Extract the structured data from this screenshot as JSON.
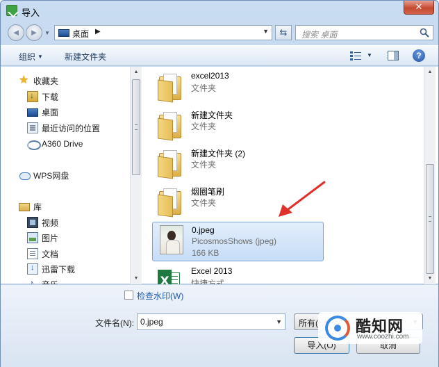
{
  "window": {
    "title": "导入",
    "close_label": "✕"
  },
  "nav": {
    "back_glyph": "◄",
    "forward_glyph": "►",
    "history_glyph": "▼",
    "address": {
      "location": "桌面",
      "separator": "▶",
      "dropdown_glyph": "▼"
    },
    "refresh_glyph": "⇆",
    "search_placeholder": "搜索 桌面"
  },
  "toolbar": {
    "organize_label": "组织",
    "organize_caret": "▼",
    "new_folder_label": "新建文件夹",
    "views_caret": "▼",
    "help_label": "?"
  },
  "sidebar": {
    "items": [
      {
        "label": "收藏夹",
        "icon": "star-icon"
      },
      {
        "label": "下载",
        "icon": "downloads-icon"
      },
      {
        "label": "桌面",
        "icon": "desktop-icon"
      },
      {
        "label": "最近访问的位置",
        "icon": "recent-places-icon"
      },
      {
        "label": "A360 Drive",
        "icon": "a360-drive-icon"
      },
      {
        "label": "WPS网盘",
        "icon": "cloud-drive-icon"
      },
      {
        "label": "库",
        "icon": "libraries-icon"
      },
      {
        "label": "视频",
        "icon": "videos-icon"
      },
      {
        "label": "图片",
        "icon": "pictures-icon"
      },
      {
        "label": "文档",
        "icon": "documents-icon"
      },
      {
        "label": "迅雷下载",
        "icon": "xunlei-download-icon"
      },
      {
        "label": "音乐",
        "icon": "music-icon"
      }
    ],
    "scroll_up": "▲",
    "scroll_down": "▼"
  },
  "files": [
    {
      "name": "excel2013",
      "line1": "文件夹",
      "line2": "",
      "icon": "folder-icon",
      "selected": false
    },
    {
      "name": "新建文件夹",
      "line1": "文件夹",
      "line2": "",
      "icon": "folder-icon",
      "selected": false
    },
    {
      "name": "新建文件夹 (2)",
      "line1": "文件夹",
      "line2": "",
      "icon": "folder-icon",
      "selected": false
    },
    {
      "name": "烟圈笔刷",
      "line1": "文件夹",
      "line2": "",
      "icon": "folder-icon",
      "selected": false
    },
    {
      "name": "0.jpeg",
      "line1": "PicosmosShows (jpeg)",
      "line2": "166 KB",
      "icon": "image-thumbnail-icon",
      "selected": true
    },
    {
      "name": "Excel 2013",
      "line1": "快捷方式",
      "line2": "",
      "icon": "excel-icon",
      "selected": false
    }
  ],
  "file_scroll": {
    "up": "▲",
    "down": "▼"
  },
  "bottom": {
    "watermark_checkbox_label": "检查水印(W)",
    "watermark_checked": false,
    "filename_label": "文件名(N):",
    "filename_value": "0.jpeg",
    "filename_dropdown": "▼",
    "filetype_value": "所有(*.*)",
    "filetype_dropdown": "▼",
    "import_label": "导入(O)",
    "cancel_label": "取消"
  },
  "watermark_logo": {
    "title": "酷知网",
    "url": "www.coozhi.com"
  },
  "colors": {
    "accent": "#3c7fb1",
    "selection": "#c7ddf7",
    "annotation_arrow": "#e0302a"
  }
}
